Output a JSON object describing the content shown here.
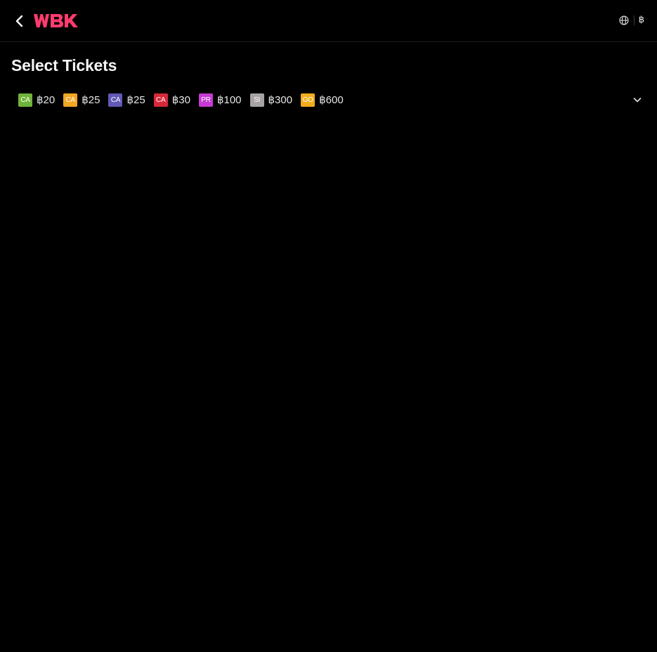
{
  "header": {
    "back_icon": "chevron-left-icon",
    "logo_text": "WBK",
    "logo_color": "#ff3b6e",
    "language_icon": "globe-icon",
    "currency_symbol": "฿"
  },
  "page": {
    "title": "Select Tickets"
  },
  "tickets": [
    {
      "code": "CA",
      "price": "฿20",
      "color": "#6fb43a"
    },
    {
      "code": "CA",
      "price": "฿25",
      "color": "#f2a623"
    },
    {
      "code": "CA",
      "price": "฿25",
      "color": "#6258b6"
    },
    {
      "code": "CA",
      "price": "฿30",
      "color": "#d7283a"
    },
    {
      "code": "PR",
      "price": "฿100",
      "color": "#c53ad2"
    },
    {
      "code": "SI",
      "price": "฿300",
      "color": "#a7a3a3"
    },
    {
      "code": "GO",
      "price": "฿600",
      "color": "#f2ad1b"
    }
  ],
  "expand_icon": "chevron-down-icon"
}
